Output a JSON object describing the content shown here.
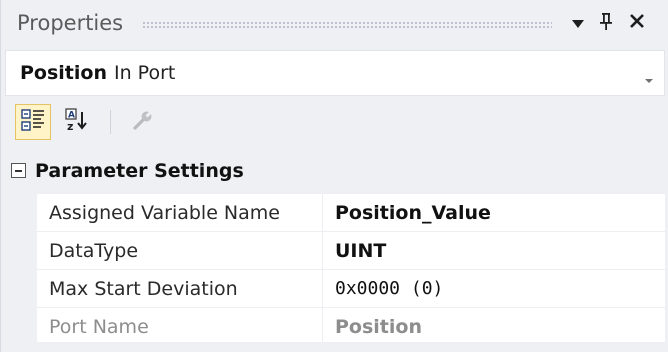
{
  "panel": {
    "title": "Properties"
  },
  "selector": {
    "object_name": "Position",
    "object_type": "In Port"
  },
  "toolbar": {
    "categorized_icon": "categorized-view-icon",
    "alphabetical_icon": "alphabetical-sort-icon",
    "property_pages_icon": "property-pages-wrench-icon"
  },
  "grid": {
    "category": "Parameter Settings",
    "rows": [
      {
        "name": "Assigned Variable Name",
        "value": "Position_Value"
      },
      {
        "name": "DataType",
        "value": "UINT"
      },
      {
        "name": "Max Start Deviation",
        "value": "0x0000 (0)"
      },
      {
        "name": "Port Name",
        "value": "Position"
      }
    ]
  },
  "colors": {
    "panel_bg": "#eef0f4",
    "selected_tool_bg": "#fff3c8",
    "selected_tool_border": "#e5c365",
    "disabled_text": "#8d8d8d"
  }
}
